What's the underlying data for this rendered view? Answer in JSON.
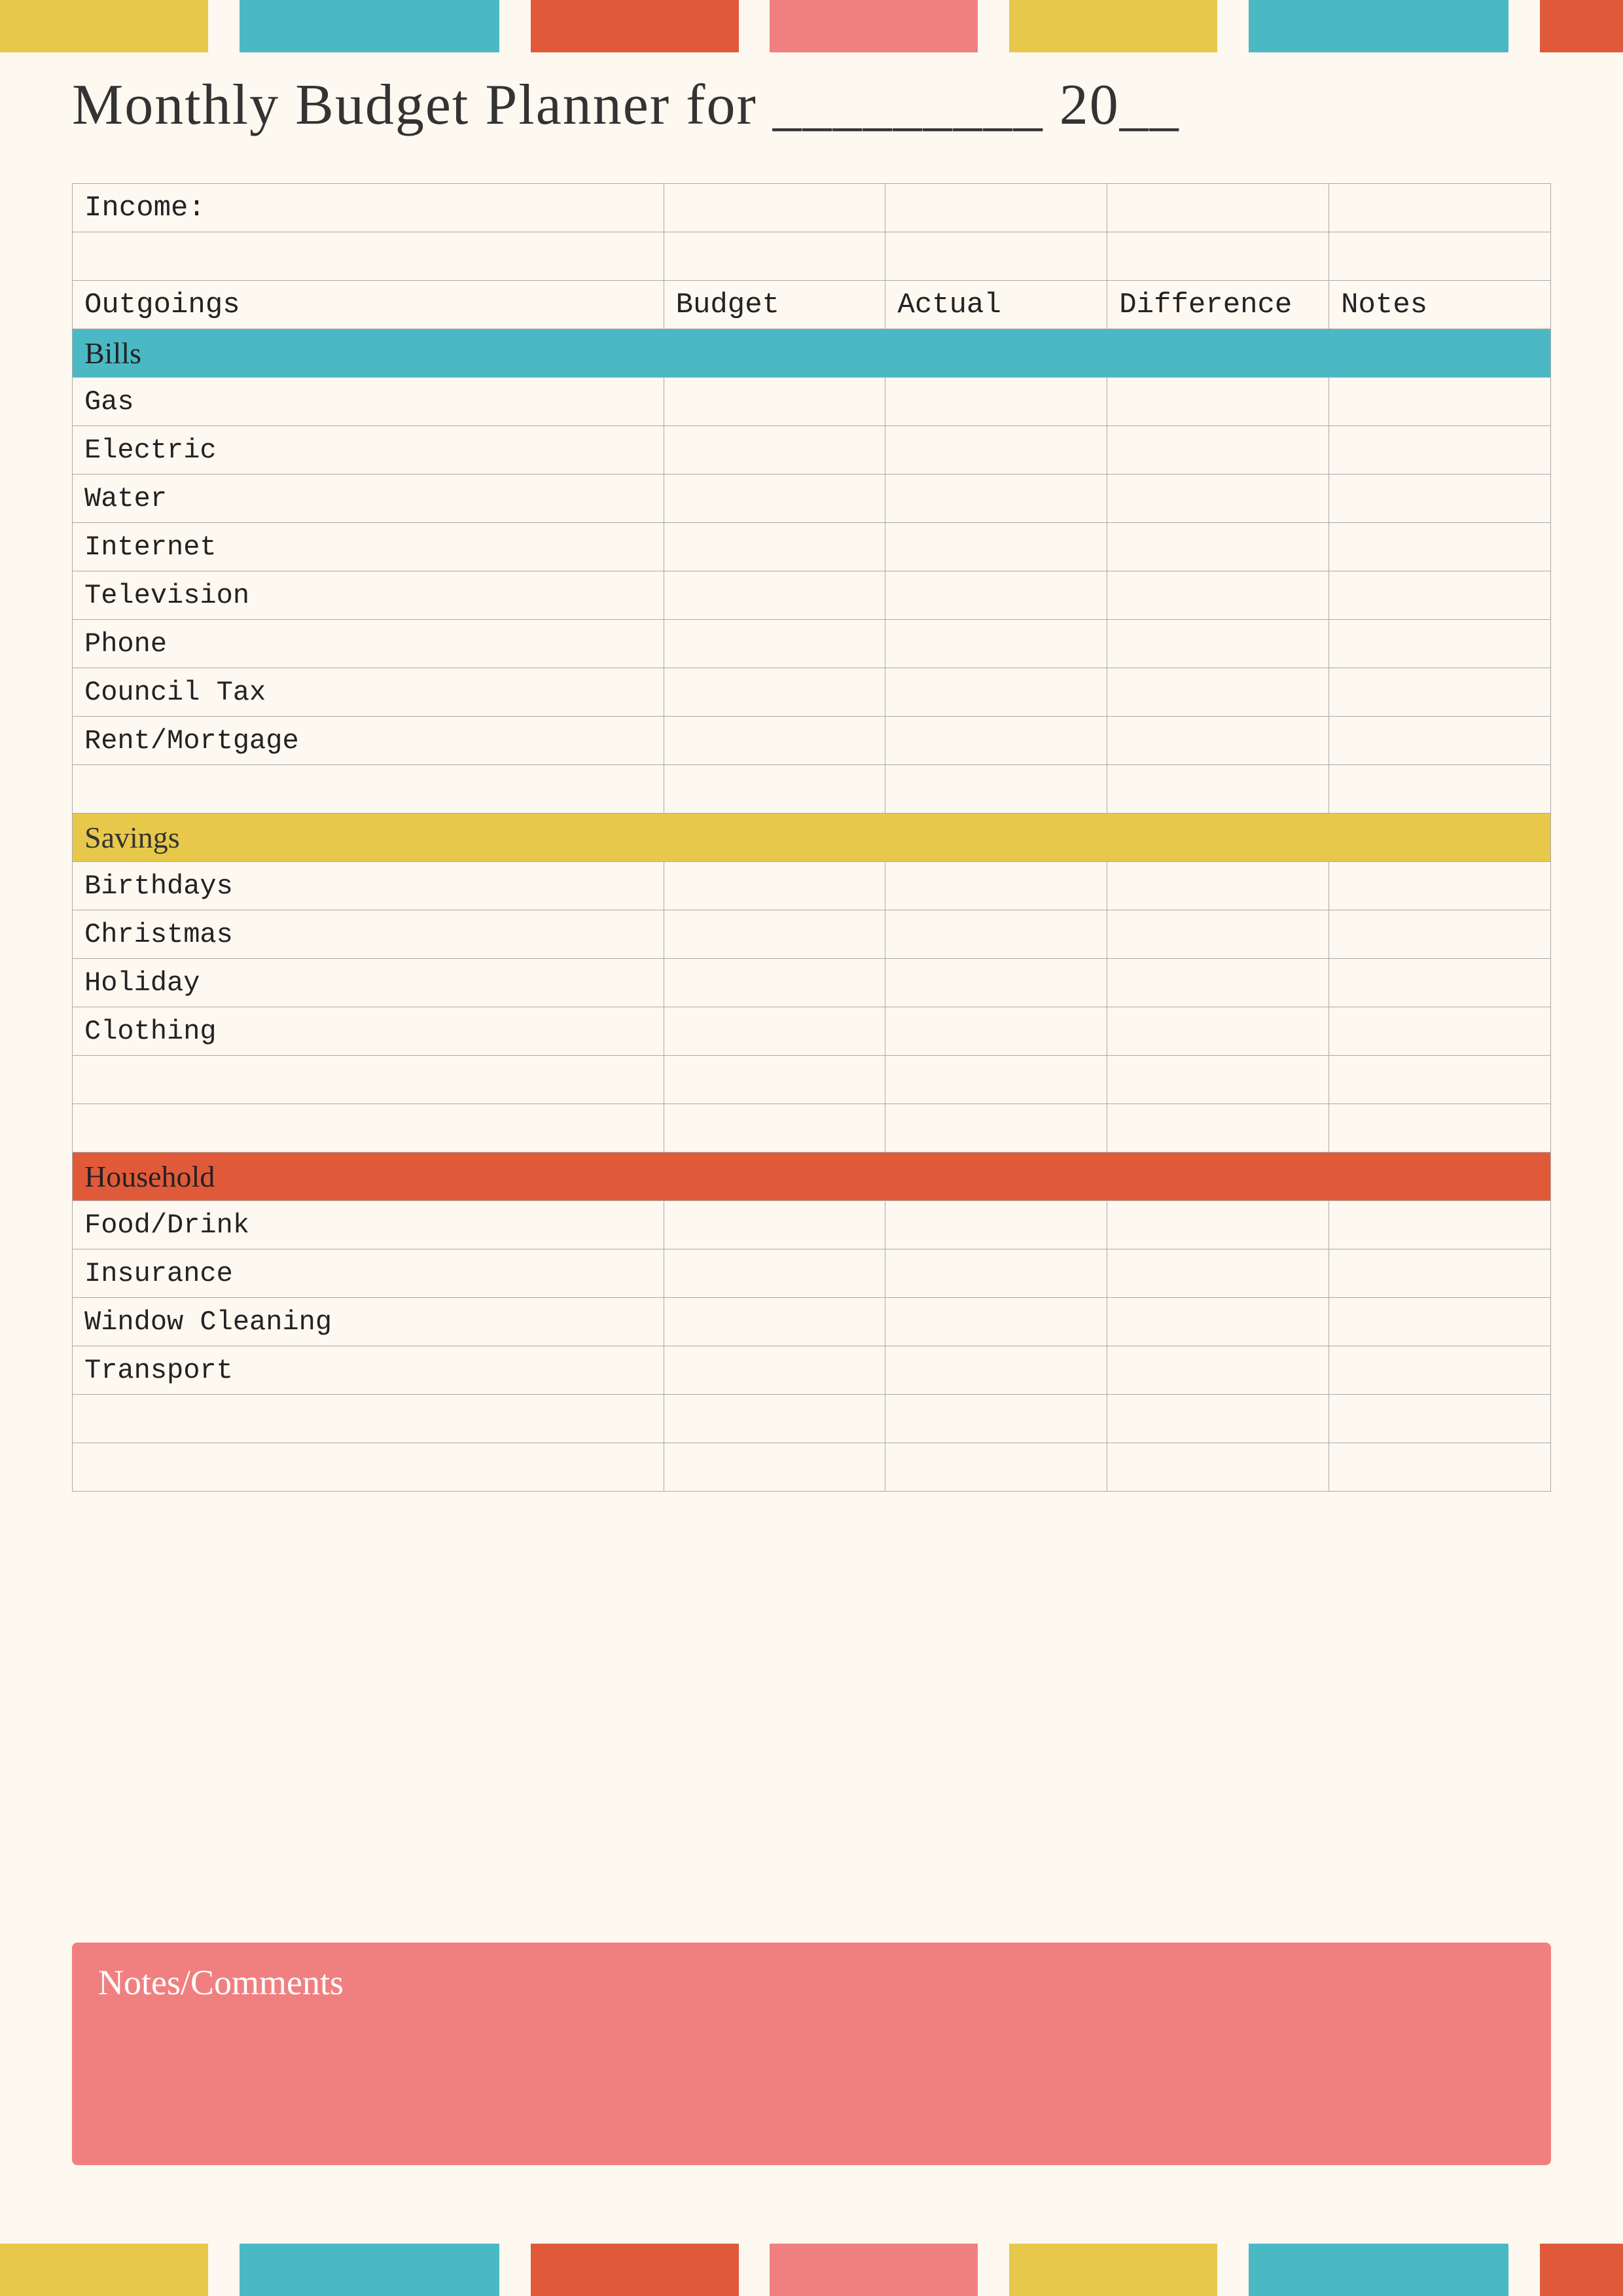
{
  "page": {
    "title": "Monthly Budget Planner for _________ 20__",
    "background": "#fdf8f0"
  },
  "colorBars": {
    "top": [
      {
        "color": "#e8c84a",
        "flex": 2
      },
      {
        "color": "#fdf8f0",
        "flex": 0.3
      },
      {
        "color": "#4ab9c4",
        "flex": 2.5
      },
      {
        "color": "#fdf8f0",
        "flex": 0.3
      },
      {
        "color": "#e05a3a",
        "flex": 2
      },
      {
        "color": "#fdf8f0",
        "flex": 0.3
      },
      {
        "color": "#f08080",
        "flex": 2
      },
      {
        "color": "#fdf8f0",
        "flex": 0.3
      },
      {
        "color": "#e8c84a",
        "flex": 2
      },
      {
        "color": "#fdf8f0",
        "flex": 0.3
      },
      {
        "color": "#4ab9c4",
        "flex": 2.5
      },
      {
        "color": "#fdf8f0",
        "flex": 0.3
      },
      {
        "color": "#e05a3a",
        "flex": 0.8
      }
    ],
    "bottom": [
      {
        "color": "#e8c84a",
        "flex": 2
      },
      {
        "color": "#fdf8f0",
        "flex": 0.3
      },
      {
        "color": "#4ab9c4",
        "flex": 2.5
      },
      {
        "color": "#fdf8f0",
        "flex": 0.3
      },
      {
        "color": "#e05a3a",
        "flex": 2
      },
      {
        "color": "#fdf8f0",
        "flex": 0.3
      },
      {
        "color": "#f08080",
        "flex": 2
      },
      {
        "color": "#fdf8f0",
        "flex": 0.3
      },
      {
        "color": "#e8c84a",
        "flex": 2
      },
      {
        "color": "#fdf8f0",
        "flex": 0.3
      },
      {
        "color": "#4ab9c4",
        "flex": 2.5
      },
      {
        "color": "#fdf8f0",
        "flex": 0.3
      },
      {
        "color": "#e05a3a",
        "flex": 0.8
      }
    ]
  },
  "table": {
    "headers": {
      "outgoings": "Outgoings",
      "budget": "Budget",
      "actual": "Actual",
      "difference": "Difference",
      "notes": "Notes",
      "income": "Income:"
    },
    "sections": {
      "bills": {
        "label": "Bills",
        "items": [
          "Gas",
          "Electric",
          "Water",
          "Internet",
          "Television",
          "Phone",
          "Council Tax",
          "Rent/Mortgage"
        ]
      },
      "savings": {
        "label": "Savings",
        "items": [
          "Birthdays",
          "Christmas",
          "Holiday",
          "Clothing"
        ]
      },
      "household": {
        "label": "Household",
        "items": [
          "Food/Drink",
          "Insurance",
          "Window Cleaning",
          "Transport"
        ]
      }
    }
  },
  "notesSection": {
    "label": "Notes/Comments"
  }
}
